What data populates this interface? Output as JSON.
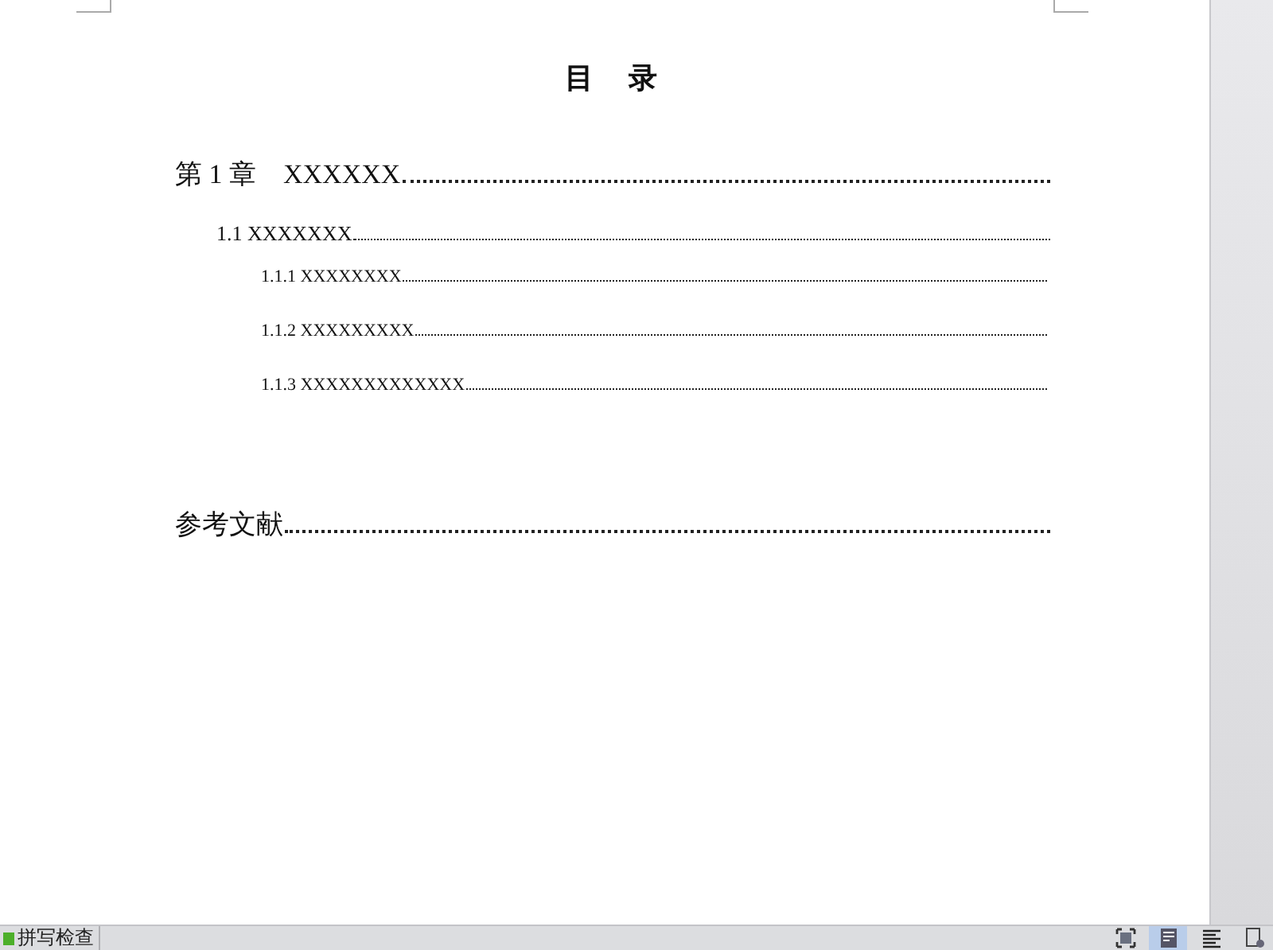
{
  "document": {
    "title": "目　录",
    "toc": [
      {
        "text": "第 1 章　XXXXXX",
        "children": [
          {
            "text": "1.1 XXXXXXX",
            "children": [
              {
                "text": "1.1.1 XXXXXXXX"
              },
              {
                "text": "1.1.2 XXXXXXXXX"
              },
              {
                "text": "1.1.3 XXXXXXXXXXXXX"
              }
            ]
          }
        ]
      },
      {
        "text": "参考文献"
      }
    ]
  },
  "status_bar": {
    "spell_check": "拼写检查",
    "view_buttons": [
      {
        "selected": false
      },
      {
        "selected": true
      },
      {
        "selected": false
      },
      {
        "selected": false
      }
    ]
  }
}
